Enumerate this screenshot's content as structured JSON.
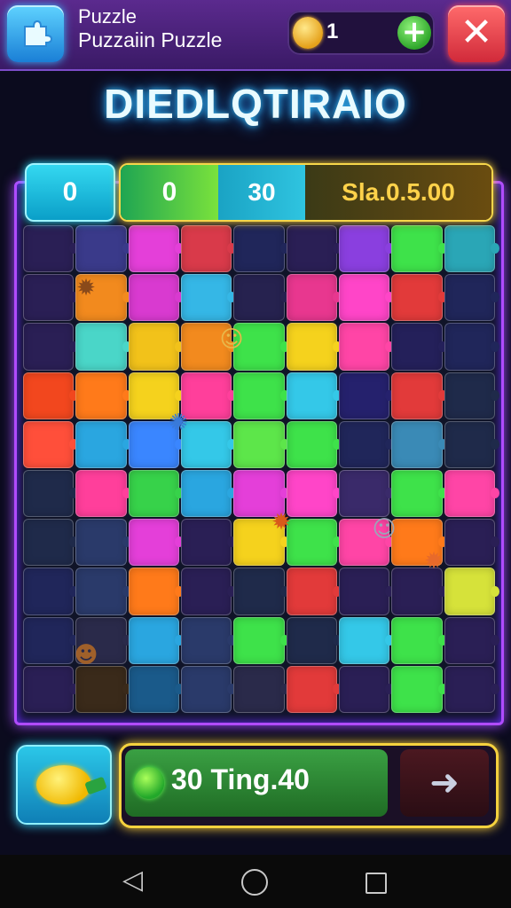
{
  "header": {
    "title_line1": "Puzzle",
    "title_line2": "Puzzaiin Puzzle",
    "coins": "1",
    "plus_label": "+",
    "close_label": "✕"
  },
  "heading": "DIEDLQTIRAIO",
  "scores": {
    "left": "0",
    "seg_a": "0",
    "seg_b": "30",
    "seg_c": "Sla.0.5.00"
  },
  "board": {
    "tiles": [
      "#2a1f55",
      "#3a3a8a",
      "#e43fd9",
      "#d93a4a",
      "#20265a",
      "#2a1f55",
      "#8a3fdf",
      "#3ee24a",
      "#2aa6b6",
      "#2a1f55",
      "#f28a1e",
      "#d93ad0",
      "#35b7e6",
      "#26224f",
      "#e8378f",
      "#ff45c8",
      "#e23a3a",
      "#20265a",
      "#2a1f55",
      "#4ad6c8",
      "#f2c21a",
      "#f28a1e",
      "#3ee24a",
      "#f5d21d",
      "#ff45a6",
      "#24205a",
      "#20265a",
      "#f2471e",
      "#ff7a1a",
      "#f5d21d",
      "#ff3f9b",
      "#3ee24a",
      "#34c8e8",
      "#25216d",
      "#e23a3a",
      "#1f2a4a",
      "#ff4f3a",
      "#2aa6e0",
      "#3a86ff",
      "#34c8e8",
      "#5de64a",
      "#3ee24a",
      "#20265a",
      "#3a8ab6",
      "#1f2a4a",
      "#1f2a4a",
      "#ff3f9b",
      "#37d24a",
      "#2aa6e0",
      "#e43fd9",
      "#ff45c8",
      "#3a2a6a",
      "#3ee24a",
      "#ff45a6",
      "#1f2a4a",
      "#2a3a6a",
      "#e43fd9",
      "#2a1f55",
      "#f5d21d",
      "#3ee24a",
      "#ff45a6",
      "#ff7a1a",
      "#2a1f55",
      "#20265a",
      "#2a3a6a",
      "#ff7a1a",
      "#2a1f55",
      "#1f2a4a",
      "#e23a3a",
      "#2a1f55",
      "#2a1f55",
      "#d6e23a",
      "#20265a",
      "#2a2a4a",
      "#2aa6e0",
      "#2a3a6a",
      "#3ee24a",
      "#1f2a4a",
      "#34c8e8",
      "#3ee24a",
      "#2a1f55",
      "#2a1f55",
      "#3a2a1a",
      "#1a5a8a",
      "#2a3a6a",
      "#2a2a4a",
      "#e23a3a",
      "#2a1f55",
      "#3ee24a",
      "#2a1f55"
    ],
    "critters": [
      {
        "icon": "critter-brown-icon",
        "glyph": "✹",
        "color": "#8a4a1a"
      },
      {
        "icon": "critter-cat-icon",
        "glyph": "☺",
        "color": "#e8b84a"
      },
      {
        "icon": "critter-spiky-icon",
        "glyph": "✺",
        "color": "#3a7ad8"
      },
      {
        "icon": "critter-fox-icon",
        "glyph": "✹",
        "color": "#d85a1a"
      },
      {
        "icon": "critter-grey-cat-icon",
        "glyph": "☺",
        "color": "#9aa6b8"
      },
      {
        "icon": "critter-orange-icon",
        "glyph": "✹",
        "color": "#e86a2a"
      },
      {
        "icon": "critter-bear-icon",
        "glyph": "☻",
        "color": "#a0602a"
      }
    ]
  },
  "action": {
    "label": "30 Ting.40",
    "next_label": "➜"
  },
  "nav": {
    "back_label": "◁"
  }
}
